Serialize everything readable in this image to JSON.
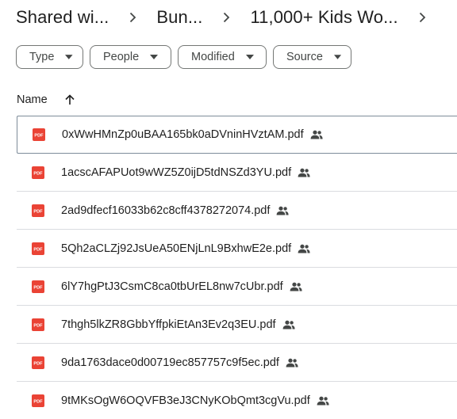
{
  "breadcrumb": [
    {
      "label": "Shared wi..."
    },
    {
      "label": "Bun..."
    },
    {
      "label": "11,000+ Kids Wo..."
    }
  ],
  "filters": [
    {
      "label": "Type"
    },
    {
      "label": "People"
    },
    {
      "label": "Modified"
    },
    {
      "label": "Source"
    }
  ],
  "list_header": {
    "name_label": "Name",
    "sort_icon": "arrow-up-icon"
  },
  "files": [
    {
      "name": "0xWwHMnZp0uBAA165bk0aDVninHVztAM.pdf",
      "icon": "pdf-icon",
      "shared": true
    },
    {
      "name": "1acscAFAPUot9wWZ5Z0ijD5tdNSZd3YU.pdf",
      "icon": "pdf-icon",
      "shared": true
    },
    {
      "name": "2ad9dfecf16033b62c8cff4378272074.pdf",
      "icon": "pdf-icon",
      "shared": true
    },
    {
      "name": "5Qh2aCLZj92JsUeA50ENjLnL9BxhwE2e.pdf",
      "icon": "pdf-icon",
      "shared": true
    },
    {
      "name": "6lY7hgPtJ3CsmC8ca0tbUrEL8nw7cUbr.pdf",
      "icon": "pdf-icon",
      "shared": true
    },
    {
      "name": "7thgh5lkZR8GbbYffpkiEtAn3Ev2q3EU.pdf",
      "icon": "pdf-icon",
      "shared": true
    },
    {
      "name": "9da1763dace0d00719ec857757c9f5ec.pdf",
      "icon": "pdf-icon",
      "shared": true
    },
    {
      "name": "9tMKsOgW6OQVFB3eJ3CNyKObQmt3cgVu.pdf",
      "icon": "pdf-icon",
      "shared": true
    }
  ],
  "colors": {
    "pdf_red": "#ea4335",
    "text": "#1f1f1f",
    "secondary_text": "#444746",
    "divider": "#dadce0"
  }
}
